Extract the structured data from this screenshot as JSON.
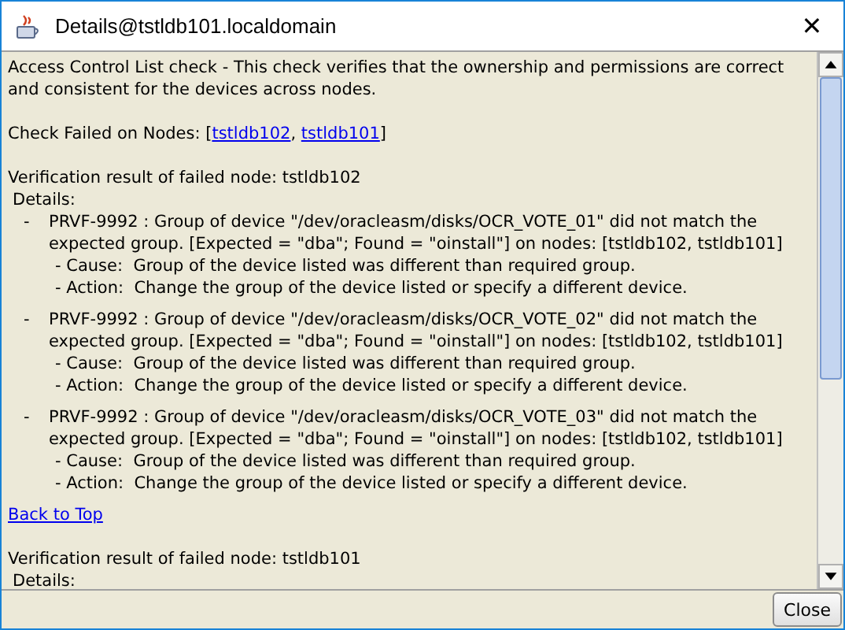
{
  "window": {
    "title": "Details@tstldb101.localdomain",
    "close_glyph": "✕"
  },
  "intro": "Access Control List check - This check verifies that the ownership and permissions are correct and consistent for the devices across nodes.",
  "failed_nodes": {
    "prefix": "Check Failed on Nodes: [",
    "links": [
      "tstldb102",
      "tstldb101"
    ],
    "separator": ",",
    "suffix": "]"
  },
  "sections": [
    {
      "heading": "Verification result of failed node: tstldb102",
      "details_label": "Details:",
      "back_link": "Back to Top",
      "errors": [
        {
          "bullet": "-",
          "message": "PRVF-9992 : Group of device \"/dev/oracleasm/disks/OCR_VOTE_01\" did not match the expected group. [Expected = \"dba\"; Found = \"oinstall\"] on nodes: [tstldb102, tstldb101]",
          "cause": "- Cause:  Group of the device listed was different than required group.",
          "action": "- Action:  Change the group of the device listed or specify a different device."
        },
        {
          "bullet": "-",
          "message": "PRVF-9992 : Group of device \"/dev/oracleasm/disks/OCR_VOTE_02\" did not match the expected group. [Expected = \"dba\"; Found = \"oinstall\"] on nodes: [tstldb102, tstldb101]",
          "cause": "- Cause:  Group of the device listed was different than required group.",
          "action": "- Action:  Change the group of the device listed or specify a different device."
        },
        {
          "bullet": "-",
          "message": "PRVF-9992 : Group of device \"/dev/oracleasm/disks/OCR_VOTE_03\" did not match the expected group. [Expected = \"dba\"; Found = \"oinstall\"] on nodes: [tstldb102, tstldb101]",
          "cause": "- Cause:  Group of the device listed was different than required group.",
          "action": "- Action:  Change the group of the device listed or specify a different device."
        }
      ]
    },
    {
      "heading": "Verification result of failed node: tstldb101",
      "details_label": "Details:"
    }
  ],
  "footer": {
    "close_button": "Close"
  }
}
